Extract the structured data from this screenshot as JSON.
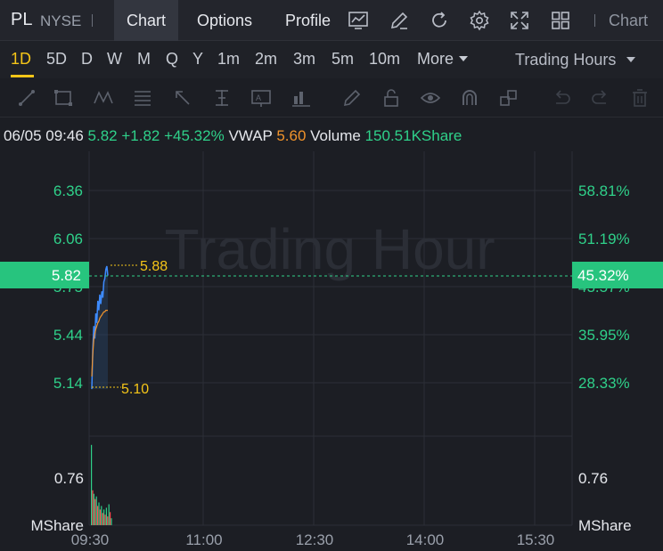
{
  "header": {
    "symbol": "PL",
    "exchange": "NYSE",
    "tabs": [
      {
        "label": "Chart",
        "active": true
      },
      {
        "label": "Options",
        "active": false
      },
      {
        "label": "Profile",
        "active": false
      }
    ],
    "toolbar_icons": [
      "indicator-chart-icon",
      "draw-pen-icon",
      "refresh-icon",
      "settings-gear-icon",
      "fullscreen-expand-icon",
      "layout-grid-icon"
    ],
    "right_tab": "Chart"
  },
  "periods": {
    "items": [
      "1D",
      "5D",
      "D",
      "W",
      "M",
      "Q",
      "Y",
      "1m",
      "2m",
      "3m",
      "5m",
      "10m"
    ],
    "active": "1D",
    "more_label": "More",
    "session_label": "Trading Hours"
  },
  "drawing_tools": [
    "line-tool-icon",
    "rectangle-tool-icon",
    "pattern-tool-icon",
    "fib-tool-icon",
    "arrow-tool-icon",
    "measure-tool-icon",
    "text-tool-icon",
    "bar-pattern-tool-icon",
    "brush-icon",
    "lock-icon",
    "eye-icon",
    "magnet-icon",
    "layers-icon",
    "undo-icon",
    "trash-icon"
  ],
  "quote": {
    "datetime": "06/05 09:46",
    "price": "5.82",
    "change": "+1.82",
    "change_pct": "+45.32%",
    "vwap_label": "VWAP",
    "vwap": "5.60",
    "volume_label": "Volume",
    "volume": "150.51KShare"
  },
  "colors": {
    "up": "#2fd18a",
    "down": "#ff4d4f",
    "price_line": "#3d8bff",
    "vwap_line": "#f0932b",
    "marker": "#f5c518",
    "background": "#1c1e24",
    "grid": "#2c2f37"
  },
  "chart": {
    "watermark": "Trading Hour",
    "current_price_badge": "5.82",
    "current_pct_badge": "45.32%",
    "high_marker": "5.88",
    "low_marker": "5.10",
    "volume_left_label": "0.76",
    "volume_unit_left": "MShare",
    "volume_right_label": "0.76",
    "volume_unit_right": "MShare"
  },
  "chart_data": {
    "type": "line",
    "x_ticks": [
      "09:30",
      "11:00",
      "12:30",
      "14:00",
      "15:30"
    ],
    "y_ticks_left": [
      "6.36",
      "6.06",
      "5.75",
      "5.44",
      "5.14"
    ],
    "y_ticks_right": [
      "58.81%",
      "51.19%",
      "43.57%",
      "35.95%",
      "28.33%"
    ],
    "ylim": [
      5.0,
      6.6
    ],
    "prev_close": 4.0,
    "series": [
      {
        "name": "Price",
        "x": [
          "09:30",
          "09:31",
          "09:32",
          "09:33",
          "09:34",
          "09:35",
          "09:36",
          "09:37",
          "09:38",
          "09:39",
          "09:40",
          "09:41",
          "09:42",
          "09:43",
          "09:44",
          "09:45",
          "09:46"
        ],
        "values": [
          5.1,
          5.35,
          5.5,
          5.42,
          5.58,
          5.52,
          5.66,
          5.6,
          5.7,
          5.64,
          5.72,
          5.68,
          5.78,
          5.8,
          5.86,
          5.88,
          5.82
        ]
      },
      {
        "name": "VWAP",
        "x": [
          "09:30",
          "09:31",
          "09:32",
          "09:33",
          "09:34",
          "09:35",
          "09:36",
          "09:37",
          "09:38",
          "09:39",
          "09:40",
          "09:41",
          "09:42",
          "09:43",
          "09:44",
          "09:45",
          "09:46"
        ],
        "values": [
          5.18,
          5.32,
          5.42,
          5.45,
          5.48,
          5.5,
          5.52,
          5.53,
          5.55,
          5.56,
          5.57,
          5.58,
          5.59,
          5.59,
          5.6,
          5.6,
          5.6
        ]
      }
    ],
    "volume": {
      "x": [
        "09:30",
        "09:31",
        "09:32",
        "09:33",
        "09:34",
        "09:35",
        "09:36",
        "09:37",
        "09:38",
        "09:39",
        "09:40",
        "09:41",
        "09:42",
        "09:43",
        "09:44",
        "09:45",
        "09:46"
      ],
      "values": [
        0.92,
        0.4,
        0.36,
        0.3,
        0.33,
        0.22,
        0.26,
        0.18,
        0.22,
        0.14,
        0.18,
        0.12,
        0.2,
        0.1,
        0.24,
        0.15,
        0.08
      ],
      "colors": [
        "up",
        "down",
        "up",
        "down",
        "up",
        "down",
        "up",
        "down",
        "up",
        "down",
        "up",
        "down",
        "up",
        "down",
        "up",
        "down",
        "up"
      ],
      "ylim": [
        0,
        1.0
      ]
    }
  }
}
